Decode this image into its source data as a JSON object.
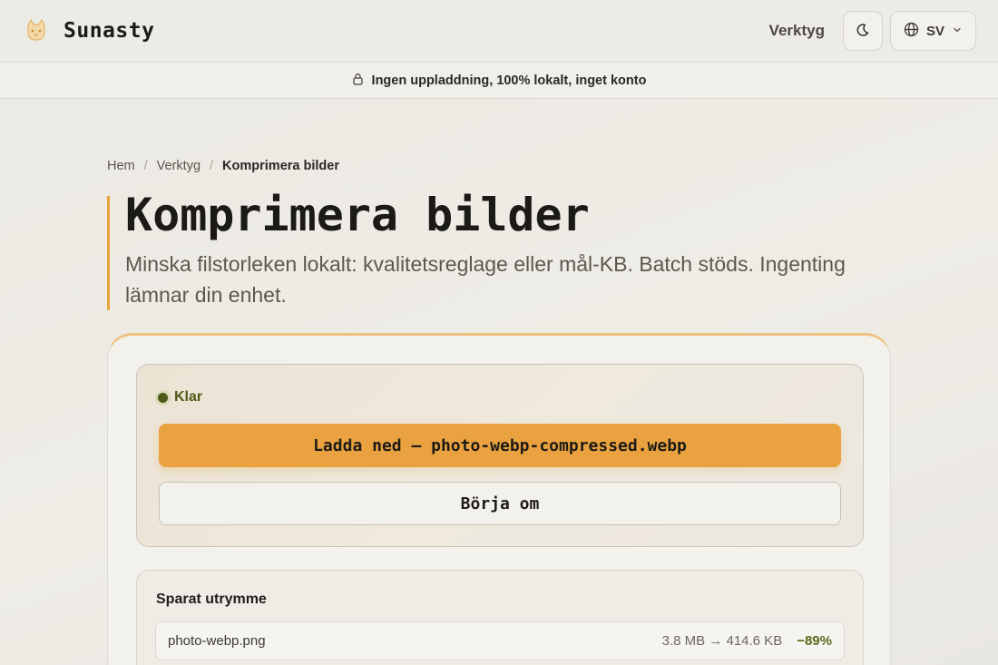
{
  "app": {
    "brand": "Sunasty"
  },
  "header": {
    "nav_tools": "Verktyg",
    "theme_icon": "moon-icon",
    "language": "SV"
  },
  "privacy_bar": {
    "text": "Ingen uppladdning, 100% lokalt, inget konto"
  },
  "breadcrumb": {
    "items": [
      "Hem",
      "Verktyg",
      "Komprimera bilder"
    ],
    "separator": "/"
  },
  "page": {
    "title": "Komprimera bilder",
    "subtitle": "Minska filstorleken lokalt: kvalitetsreglage eller mål-KB. Batch stöds. Ingenting lämnar din enhet."
  },
  "status": {
    "label": "Klar",
    "download_button": "Ladda ned — photo-webp-compressed.webp",
    "restart_button": "Börja om"
  },
  "savings": {
    "title": "Sparat utrymme",
    "files": [
      {
        "name": "photo-webp.png",
        "sizes": "3.8 MB → 414.6 KB",
        "percent": "−89%"
      }
    ]
  },
  "colors": {
    "accent": "#e9a23f",
    "status_green": "#4e5a18",
    "background": "#ebe9e3"
  }
}
